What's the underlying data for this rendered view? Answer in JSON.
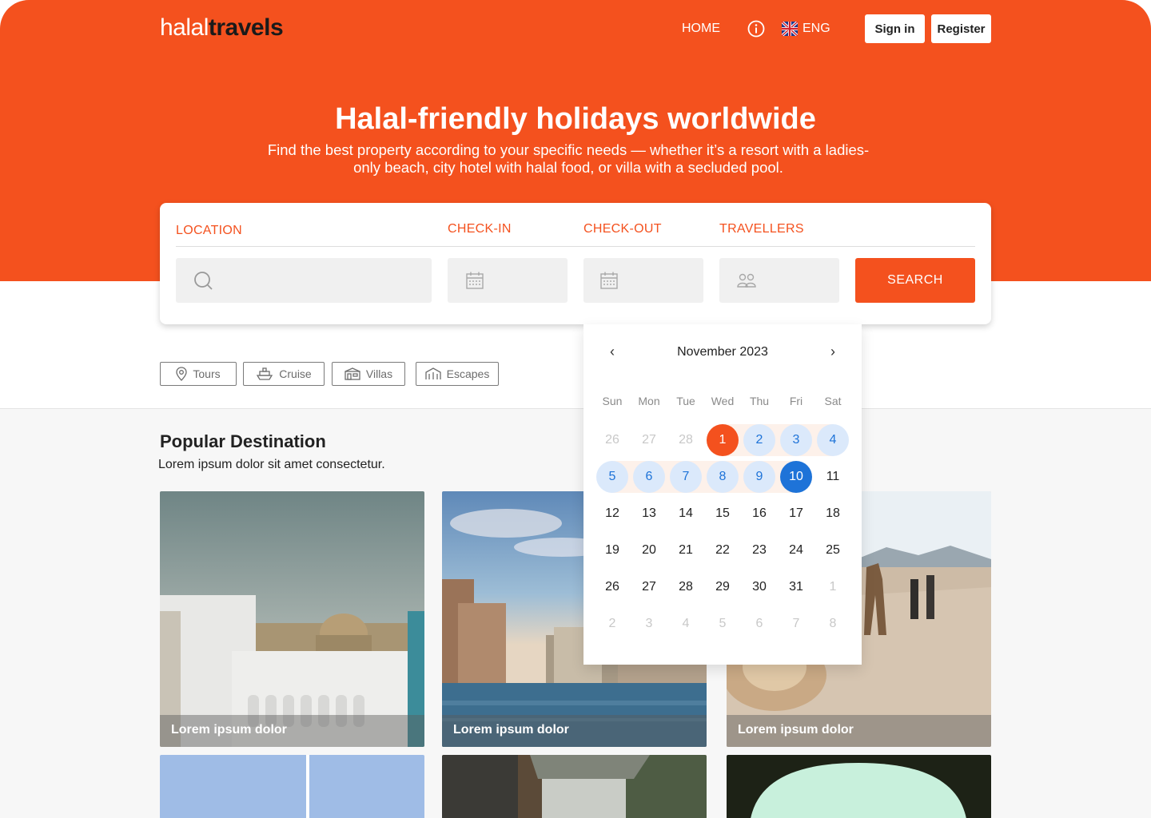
{
  "brand": {
    "part1": "halal",
    "part2": "travels",
    "accent": "#f4511e"
  },
  "nav": {
    "home": "HOME",
    "info_icon": "info-icon",
    "flag_icon": "uk-flag-icon",
    "language": "ENG",
    "signin": "Sign in",
    "register": "Register"
  },
  "hero": {
    "title": "Halal-friendly holidays worldwide",
    "subtitle": "Find the best property according to your specific needs — whether it’s a resort with a ladies-only beach, city hotel with halal food, or villa with a secluded pool."
  },
  "search": {
    "location_label": "LOCATION",
    "checkin_label": "CHECK-IN",
    "checkout_label": "CHECK-OUT",
    "travellers_label": "TRAVELLERS",
    "button": "SEARCH"
  },
  "categories": [
    {
      "label": "Tours",
      "icon": "map-pin-icon"
    },
    {
      "label": "Cruise",
      "icon": "ship-icon"
    },
    {
      "label": "Villas",
      "icon": "villa-icon"
    },
    {
      "label": "Escapes",
      "icon": "escape-icon"
    }
  ],
  "popular": {
    "title": "Popular Destination",
    "subtitle": "Lorem ipsum dolor sit amet consectetur.",
    "cards": [
      {
        "caption": "Lorem ipsum dolor"
      },
      {
        "caption": "Lorem ipsum dolor"
      },
      {
        "caption": "Lorem ipsum dolor"
      }
    ]
  },
  "calendar": {
    "month": "November 2023",
    "prev": "‹",
    "next": "›",
    "weekdays": [
      "Sun",
      "Mon",
      "Tue",
      "Wed",
      "Thu",
      "Fri",
      "Sat"
    ],
    "weeks": [
      [
        "26",
        "27",
        "28",
        "1",
        "2",
        "3",
        "4"
      ],
      [
        "5",
        "6",
        "7",
        "8",
        "9",
        "10",
        "11"
      ],
      [
        "12",
        "13",
        "14",
        "15",
        "16",
        "17",
        "18"
      ],
      [
        "19",
        "20",
        "21",
        "22",
        "23",
        "24",
        "25"
      ],
      [
        "26",
        "27",
        "28",
        "29",
        "30",
        "31",
        "1"
      ],
      [
        "2",
        "3",
        "4",
        "5",
        "6",
        "7",
        "8"
      ]
    ],
    "selected_start": "1",
    "selected_end": "10"
  }
}
